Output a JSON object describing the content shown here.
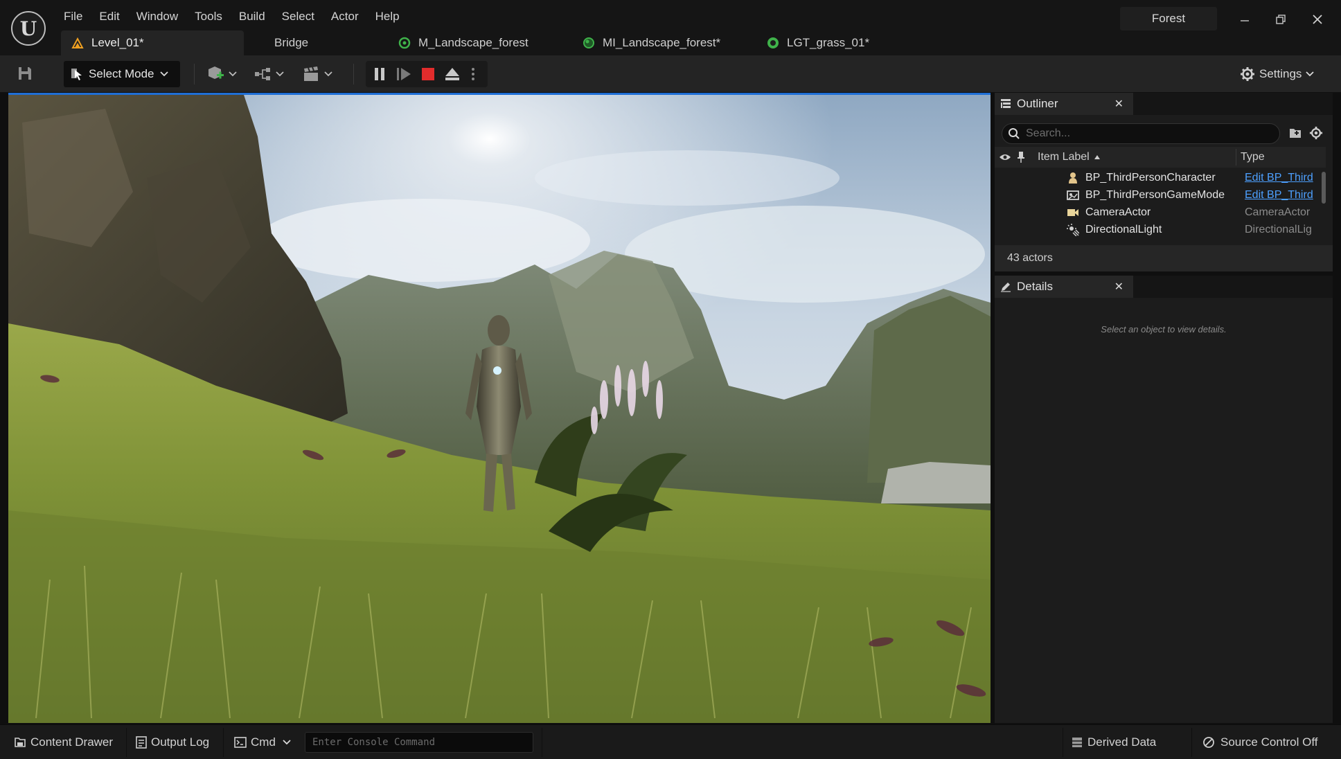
{
  "app": {
    "project_name": "Forest",
    "menu": [
      "File",
      "Edit",
      "Window",
      "Tools",
      "Build",
      "Select",
      "Actor",
      "Help"
    ]
  },
  "tabs": [
    {
      "label": "Level_01*",
      "icon": "level-icon"
    },
    {
      "label": "Bridge",
      "icon": "none"
    },
    {
      "label": "M_Landscape_forest",
      "icon": "material-icon"
    },
    {
      "label": "MI_Landscape_forest*",
      "icon": "material-instance-icon"
    },
    {
      "label": "LGT_grass_01*",
      "icon": "landscape-grass-type-icon"
    }
  ],
  "toolbar": {
    "select_mode_label": "Select Mode",
    "settings_label": "Settings"
  },
  "outliner": {
    "title": "Outliner",
    "search_placeholder": "Search...",
    "columns": {
      "label": "Item Label",
      "type": "Type"
    },
    "rows": [
      {
        "label": "BP_ThirdPersonCharacter",
        "type": "Edit BP_Third",
        "icon": "character-icon",
        "type_is_link": true
      },
      {
        "label": "BP_ThirdPersonGameMode",
        "type": "Edit BP_Third",
        "icon": "game-mode-icon",
        "type_is_link": true
      },
      {
        "label": "CameraActor",
        "type": "CameraActor",
        "icon": "camera-icon",
        "type_is_link": false
      },
      {
        "label": "DirectionalLight",
        "type": "DirectionalLig",
        "icon": "directional-light-icon",
        "type_is_link": false
      }
    ],
    "actor_count": "43 actors"
  },
  "details": {
    "title": "Details",
    "empty_message": "Select an object to view details."
  },
  "statusbar": {
    "content_drawer": "Content Drawer",
    "output_log": "Output Log",
    "cmd": "Cmd",
    "console_placeholder": "Enter Console Command",
    "derived_data": "Derived Data",
    "source_control": "Source Control Off"
  },
  "colors": {
    "accent_blue": "#1f6fd6",
    "stop_red": "#e22c2c",
    "link_blue": "#4da0ff",
    "level_orange": "#f0a020",
    "material_green": "#3fb24a"
  }
}
